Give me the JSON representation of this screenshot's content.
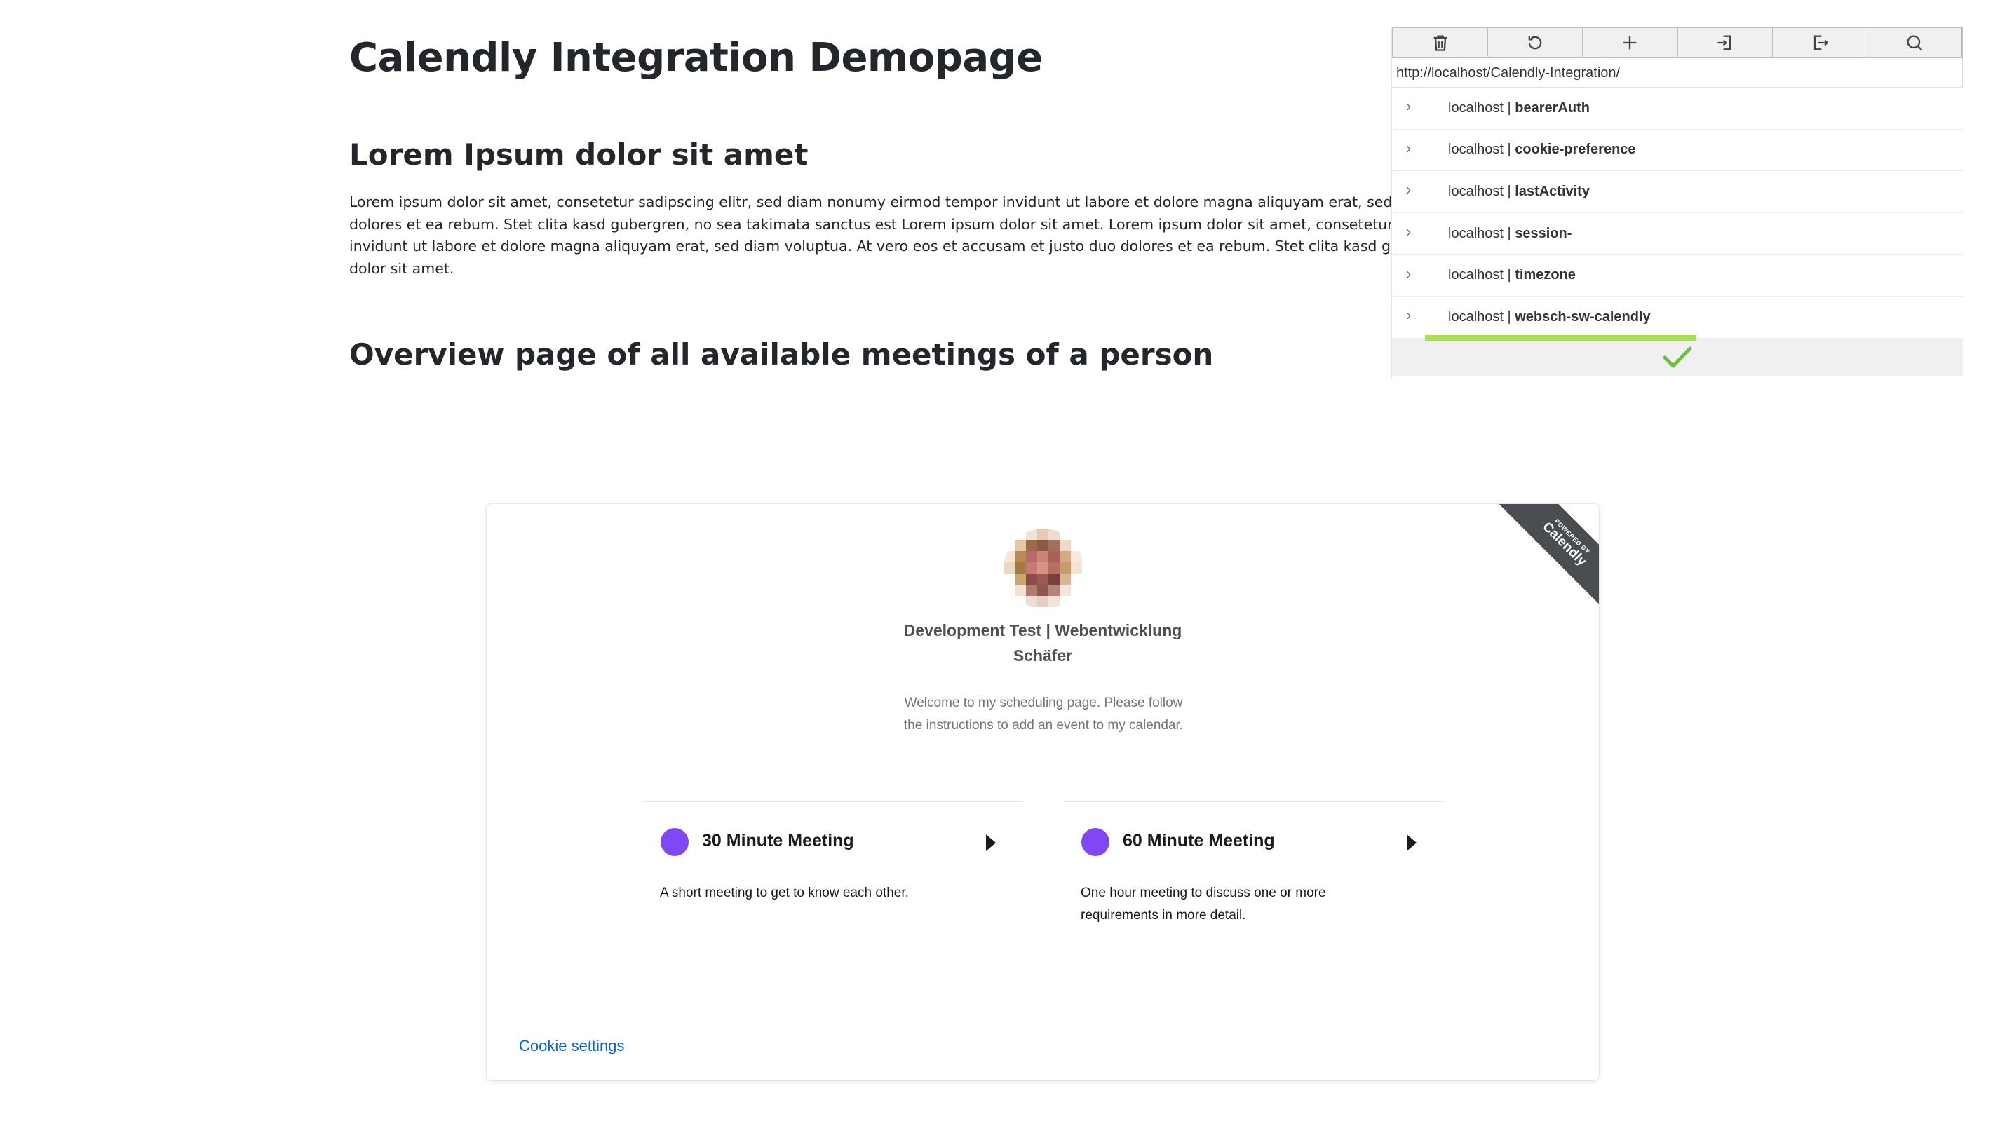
{
  "page": {
    "title": "Calendly Integration Demopage",
    "section1_heading": "Lorem Ipsum dolor sit amet",
    "section1_lines": [
      "Lorem ipsum dolor sit amet, consetetur sadipscing elitr, sed diam nonumy eirmod tempor invidunt ut labore et dolore magna aliquyam erat, sed diam v",
      "dolores et ea rebum. Stet clita kasd gubergren, no sea takimata sanctus est Lorem ipsum dolor sit amet. Lorem ipsum dolor sit amet, consetetur sadips",
      "invidunt ut labore et dolore magna aliquyam erat, sed diam voluptua. At vero eos et accusam et justo duo dolores et ea rebum. Stet clita kasd gubergre",
      "dolor sit amet."
    ],
    "section2_heading": "Overview page of all available meetings of a person"
  },
  "cookie_panel": {
    "toolbar": [
      {
        "icon": "trash-icon"
      },
      {
        "icon": "refresh-icon"
      },
      {
        "icon": "plus-icon"
      },
      {
        "icon": "import-icon"
      },
      {
        "icon": "export-icon"
      },
      {
        "icon": "search-icon"
      }
    ],
    "url": "http://localhost/Calendly-Integration/",
    "cookies": [
      {
        "host": "localhost | ",
        "name": "bearerAuth"
      },
      {
        "host": "localhost | ",
        "name": "cookie-preference"
      },
      {
        "host": "localhost | ",
        "name": "lastActivity"
      },
      {
        "host": "localhost | ",
        "name": "session-"
      },
      {
        "host": "localhost | ",
        "name": "timezone"
      },
      {
        "host": "localhost | ",
        "name": "websch-sw-calendly"
      }
    ],
    "active_index": 5,
    "status_icon": "checkmark-icon",
    "accent_color": "#a5e34a"
  },
  "calendly": {
    "owner_name_line1": "Development Test | Webentwicklung",
    "owner_name_line2": "Schäfer",
    "welcome_text": "Welcome to my scheduling page. Please follow the instructions to add an event to my calendar.",
    "ribbon_small": "POWERED BY",
    "ribbon_brand": "Calendly",
    "events": [
      {
        "title": "30 Minute Meeting",
        "description": "A short meeting to get to know each other.",
        "color": "#8247f5"
      },
      {
        "title": "60 Minute Meeting",
        "description": "One hour meeting to discuss one or more requirements in more detail.",
        "color": "#8247f5"
      }
    ],
    "cookie_settings_label": "Cookie settings",
    "link_color": "#0a63c9"
  }
}
